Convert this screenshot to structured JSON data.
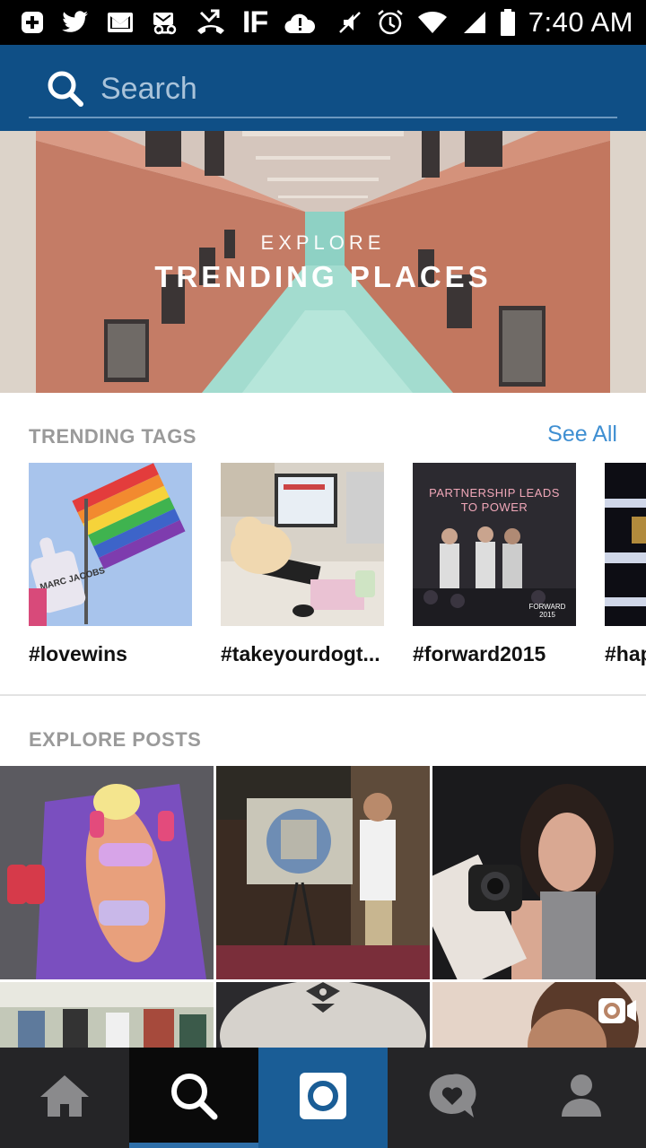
{
  "status_bar": {
    "time": "7:40 AM",
    "icons_left": [
      "add-box-icon",
      "twitter-icon",
      "gmail-icon",
      "voicemail-icon",
      "missed-call-icon",
      "ifttt-icon",
      "cloud-alert-icon"
    ],
    "icons_right": [
      "mute-icon",
      "alarm-icon",
      "wifi-icon",
      "signal-icon",
      "battery-icon"
    ],
    "ifttt_label": "IF"
  },
  "search": {
    "placeholder": "Search",
    "value": ""
  },
  "banner": {
    "eyebrow": "EXPLORE",
    "title": "TRENDING PLACES"
  },
  "trending_tags": {
    "label": "TRENDING TAGS",
    "see_all": "See All",
    "items": [
      {
        "tag": "#lovewins"
      },
      {
        "tag": "#takeyourdogt..."
      },
      {
        "tag": "#forward2015",
        "image_text": "PARTNERSHIP LEADS TO POWER",
        "image_caption": "FORWARD 2015"
      },
      {
        "tag": "#hap"
      }
    ],
    "sign_text": "MARC JACOBS"
  },
  "explore_posts": {
    "label": "EXPLORE POSTS"
  },
  "bottom_nav": [
    {
      "name": "home",
      "icon": "home-icon",
      "active": false
    },
    {
      "name": "search",
      "icon": "search-icon",
      "active": true
    },
    {
      "name": "camera",
      "icon": "camera-icon",
      "active": false
    },
    {
      "name": "activity",
      "icon": "heart-bubble-icon",
      "active": false
    },
    {
      "name": "profile",
      "icon": "person-icon",
      "active": false
    }
  ],
  "colors": {
    "header_bg": "#0f4f86",
    "accent_link": "#3f8fd2",
    "nav_bg": "#252527",
    "nav_camera_bg": "#1a5d96"
  }
}
